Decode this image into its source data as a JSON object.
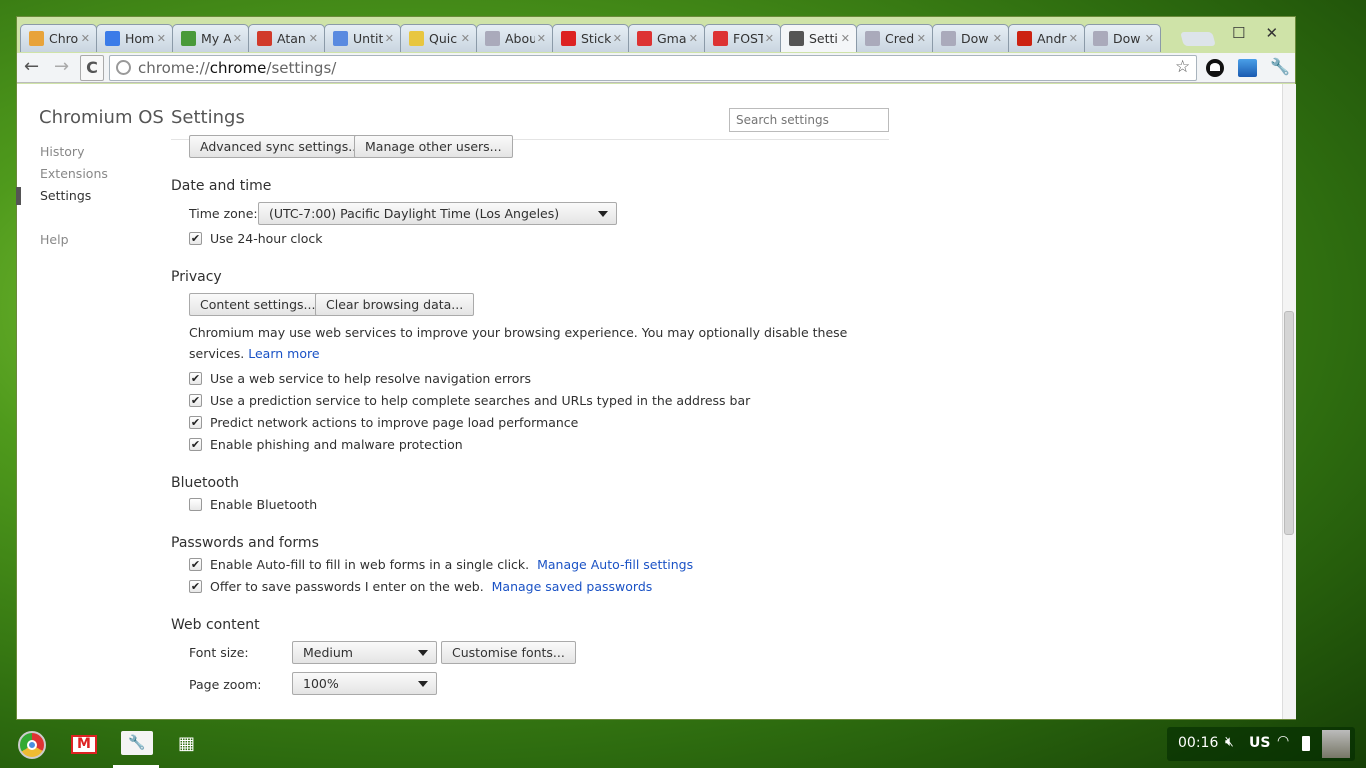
{
  "tabs": [
    {
      "label": "Chro",
      "icon": "chrome-store-icon",
      "color": "#e8a33a"
    },
    {
      "label": "Hom",
      "icon": "docs-icon",
      "color": "#3b7be8"
    },
    {
      "label": "My A",
      "icon": "google-icon",
      "color": "#4a9a3a"
    },
    {
      "label": "Atan",
      "icon": "google-plus-icon",
      "color": "#d13a2a"
    },
    {
      "label": "Untit",
      "icon": "document-icon",
      "color": "#5a8ae0"
    },
    {
      "label": "Quic",
      "icon": "notepad-icon",
      "color": "#e8c640"
    },
    {
      "label": "Abou",
      "icon": "globe-icon",
      "color": "#aab"
    },
    {
      "label": "Stick",
      "icon": "checkmark-icon",
      "color": "#d22"
    },
    {
      "label": "Gma",
      "icon": "gmail-icon",
      "color": "#d33"
    },
    {
      "label": "FOST",
      "icon": "gmail-icon",
      "color": "#d33"
    },
    {
      "label": "Setti",
      "icon": "wrench-icon",
      "color": "#555",
      "active": true
    },
    {
      "label": "Cred",
      "icon": "globe-icon",
      "color": "#aab"
    },
    {
      "label": "Dow",
      "icon": "globe-icon",
      "color": "#aab"
    },
    {
      "label": "Andr",
      "icon": "youtube-icon",
      "color": "#c21"
    },
    {
      "label": "Dow",
      "icon": "globe-icon",
      "color": "#aab"
    }
  ],
  "omnibox": {
    "scheme": "chrome://",
    "host": "chrome",
    "path": "/settings/"
  },
  "sidebar": {
    "title": "Chromium OS",
    "items": [
      "History",
      "Extensions",
      "Settings",
      "Help"
    ]
  },
  "page": {
    "title": "Settings",
    "search_placeholder": "Search settings"
  },
  "sync": {
    "advanced": "Advanced sync settings...",
    "manage_users": "Manage other users..."
  },
  "datetime": {
    "heading": "Date and time",
    "tz_label": "Time zone:",
    "tz_value": "(UTC-7:00) Pacific Daylight Time (Los Angeles)",
    "clock24": "Use 24-hour clock"
  },
  "privacy": {
    "heading": "Privacy",
    "content_settings": "Content settings...",
    "clear_data": "Clear browsing data...",
    "desc1": "Chromium may use web services to improve your browsing experience. You may optionally disable these",
    "desc2": "services.",
    "learn_more": "Learn more",
    "options": [
      "Use a web service to help resolve navigation errors",
      "Use a prediction service to help complete searches and URLs typed in the address bar",
      "Predict network actions to improve page load performance",
      "Enable phishing and malware protection"
    ]
  },
  "bluetooth": {
    "heading": "Bluetooth",
    "enable": "Enable Bluetooth"
  },
  "passwords": {
    "heading": "Passwords and forms",
    "autofill": "Enable Auto-fill to fill in web forms in a single click.",
    "autofill_link": "Manage Auto-fill settings",
    "save_pw": "Offer to save passwords I enter on the web.",
    "save_pw_link": "Manage saved passwords"
  },
  "webcontent": {
    "heading": "Web content",
    "font_size_label": "Font size:",
    "font_size": "Medium",
    "customise": "Customise fonts...",
    "zoom_label": "Page zoom:",
    "zoom": "100%"
  },
  "tray": {
    "time": "00:16",
    "keyboard": "US"
  }
}
